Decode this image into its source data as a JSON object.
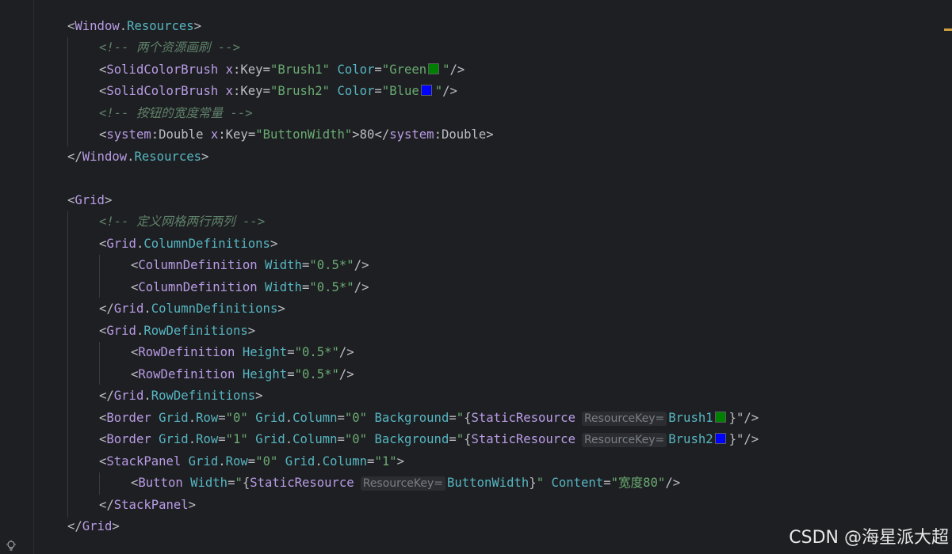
{
  "watermark": "CSDN @海星派大超",
  "colors": {
    "background": "#1e1f22",
    "green_swatch": "#008000",
    "blue_swatch": "#0000ff"
  },
  "code": {
    "l1": {
      "open": "<",
      "ns": "Window",
      "dot": ".",
      "name": "Resources",
      "close": ">"
    },
    "l2": {
      "comment": "<!-- 两个资源画刷 -->"
    },
    "l3": {
      "open": "<",
      "tag": "SolidColorBrush",
      "sp1": " ",
      "xns": "x",
      "colon": ":",
      "keyattr": "Key",
      "eq1": "=",
      "keyval": "\"Brush1\"",
      "sp2": " ",
      "colorattr": "Color",
      "eq2": "=",
      "q1": "\"",
      "colorval": "Green",
      "q2": "\"",
      "end": "/>"
    },
    "l4": {
      "open": "<",
      "tag": "SolidColorBrush",
      "sp1": " ",
      "xns": "x",
      "colon": ":",
      "keyattr": "Key",
      "eq1": "=",
      "keyval": "\"Brush2\"",
      "sp2": " ",
      "colorattr": "Color",
      "eq2": "=",
      "q1": "\"",
      "colorval": "Blue",
      "q2": "\"",
      "end": "/>"
    },
    "l5": {
      "comment": "<!-- 按钮的宽度常量 -->"
    },
    "l6": {
      "open": "<",
      "ns": "system",
      "colon": ":",
      "tag": "Double",
      "sp": " ",
      "xns": "x",
      "colon2": ":",
      "keyattr": "Key",
      "eq": "=",
      "keyval": "\"ButtonWidth\"",
      "gt": ">",
      "content": "80",
      "closeopen": "</",
      "ns2": "system",
      "colon3": ":",
      "tag2": "Double",
      "close": ">"
    },
    "l7": {
      "open": "</",
      "ns": "Window",
      "dot": ".",
      "name": "Resources",
      "close": ">"
    },
    "l9": {
      "open": "<",
      "tag": "Grid",
      "close": ">"
    },
    "l10": {
      "comment": "<!-- 定义网格两行两列 -->"
    },
    "l11": {
      "open": "<",
      "ns": "Grid",
      "dot": ".",
      "name": "ColumnDefinitions",
      "close": ">"
    },
    "l12": {
      "open": "<",
      "tag": "ColumnDefinition",
      "sp": " ",
      "attr": "Width",
      "eq": "=",
      "val": "\"0.5*\"",
      "end": "/>"
    },
    "l13": {
      "open": "<",
      "tag": "ColumnDefinition",
      "sp": " ",
      "attr": "Width",
      "eq": "=",
      "val": "\"0.5*\"",
      "end": "/>"
    },
    "l14": {
      "open": "</",
      "ns": "Grid",
      "dot": ".",
      "name": "ColumnDefinitions",
      "close": ">"
    },
    "l15": {
      "open": "<",
      "ns": "Grid",
      "dot": ".",
      "name": "RowDefinitions",
      "close": ">"
    },
    "l16": {
      "open": "<",
      "tag": "RowDefinition",
      "sp": " ",
      "attr": "Height",
      "eq": "=",
      "val": "\"0.5*\"",
      "end": "/>"
    },
    "l17": {
      "open": "<",
      "tag": "RowDefinition",
      "sp": " ",
      "attr": "Height",
      "eq": "=",
      "val": "\"0.5*\"",
      "end": "/>"
    },
    "l18": {
      "open": "</",
      "ns": "Grid",
      "dot": ".",
      "name": "RowDefinitions",
      "close": ">"
    },
    "l19": {
      "open": "<",
      "tag": "Border",
      "sp1": " ",
      "a1ns": "Grid",
      "dot1": ".",
      "a1": "Row",
      "eq1": "=",
      "v1": "\"0\"",
      "sp2": " ",
      "a2ns": "Grid",
      "dot2": ".",
      "a2": "Column",
      "eq2": "=",
      "v2": "\"0\"",
      "sp3": " ",
      "a3": "Background",
      "eq3": "=",
      "q": "\"",
      "brace": "{",
      "ext": "StaticResource",
      "hint": "ResourceKey=",
      "res": "Brush1",
      "endbrace": "}",
      "end": "\"/>"
    },
    "l20": {
      "open": "<",
      "tag": "Border",
      "sp1": " ",
      "a1ns": "Grid",
      "dot1": ".",
      "a1": "Row",
      "eq1": "=",
      "v1": "\"1\"",
      "sp2": " ",
      "a2ns": "Grid",
      "dot2": ".",
      "a2": "Column",
      "eq2": "=",
      "v2": "\"0\"",
      "sp3": " ",
      "a3": "Background",
      "eq3": "=",
      "q": "\"",
      "brace": "{",
      "ext": "StaticResource",
      "hint": "ResourceKey=",
      "res": "Brush2",
      "endbrace": "}",
      "end": "\"/>"
    },
    "l21": {
      "open": "<",
      "tag": "StackPanel",
      "sp1": " ",
      "a1ns": "Grid",
      "dot1": ".",
      "a1": "Row",
      "eq1": "=",
      "v1": "\"0\"",
      "sp2": " ",
      "a2ns": "Grid",
      "dot2": ".",
      "a2": "Column",
      "eq2": "=",
      "v2": "\"1\"",
      "close": ">"
    },
    "l22": {
      "open": "<",
      "tag": "Button",
      "sp1": " ",
      "a1": "Width",
      "eq1": "=",
      "q": "\"",
      "brace": "{",
      "ext": "StaticResource",
      "hint": "ResourceKey=",
      "res": "ButtonWidth",
      "endbrace": "}",
      "q2": "\"",
      "sp2": " ",
      "a2": "Content",
      "eq2": "=",
      "v2": "\"宽度80\"",
      "end": "/>"
    },
    "l23": {
      "open": "</",
      "tag": "StackPanel",
      "close": ">"
    },
    "l24": {
      "open": "</",
      "tag": "Grid",
      "close": ">"
    }
  }
}
